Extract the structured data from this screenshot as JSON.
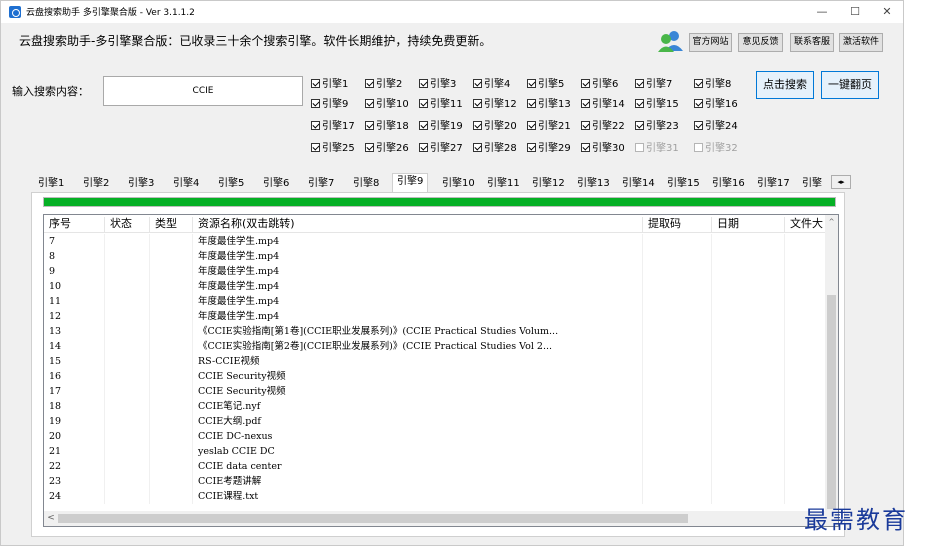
{
  "window": {
    "title": "云盘搜索助手 多引擎聚合版 - Ver 3.1.1.2",
    "min_glyph": "—",
    "max_glyph": "☐",
    "close_glyph": "✕"
  },
  "header": {
    "slogan": "云盘搜索助手-多引擎聚合版：已收录三十余个搜索引擎。软件长期维护，持续免费更新。",
    "user_icon": "user-group-icon",
    "buttons": [
      "官方网站",
      "意见反馈",
      "联系客服",
      "激活软件"
    ]
  },
  "search": {
    "label": "输入搜索内容：",
    "value": "CCIE",
    "search_button": "点击搜索",
    "next_page_button": "一键翻页"
  },
  "engines": [
    {
      "label": "引擎1",
      "checked": true
    },
    {
      "label": "引擎2",
      "checked": true
    },
    {
      "label": "引擎3",
      "checked": true
    },
    {
      "label": "引擎4",
      "checked": true
    },
    {
      "label": "引擎5",
      "checked": true
    },
    {
      "label": "引擎6",
      "checked": true
    },
    {
      "label": "引擎7",
      "checked": true
    },
    {
      "label": "引擎8",
      "checked": true
    },
    {
      "label": "引擎9",
      "checked": true
    },
    {
      "label": "引擎10",
      "checked": true
    },
    {
      "label": "引擎11",
      "checked": true
    },
    {
      "label": "引擎12",
      "checked": true
    },
    {
      "label": "引擎13",
      "checked": true
    },
    {
      "label": "引擎14",
      "checked": true
    },
    {
      "label": "引擎15",
      "checked": true
    },
    {
      "label": "引擎16",
      "checked": true
    },
    {
      "label": "引擎17",
      "checked": true
    },
    {
      "label": "引擎18",
      "checked": true
    },
    {
      "label": "引擎19",
      "checked": true
    },
    {
      "label": "引擎20",
      "checked": true
    },
    {
      "label": "引擎21",
      "checked": true
    },
    {
      "label": "引擎22",
      "checked": true
    },
    {
      "label": "引擎23",
      "checked": true
    },
    {
      "label": "引擎24",
      "checked": true
    },
    {
      "label": "引擎25",
      "checked": true
    },
    {
      "label": "引擎26",
      "checked": true
    },
    {
      "label": "引擎27",
      "checked": true
    },
    {
      "label": "引擎28",
      "checked": true
    },
    {
      "label": "引擎29",
      "checked": true
    },
    {
      "label": "引擎30",
      "checked": true
    },
    {
      "label": "引擎31",
      "checked": false,
      "disabled": true
    },
    {
      "label": "引擎32",
      "checked": false,
      "disabled": true
    }
  ],
  "tabs": {
    "items": [
      "引擎1",
      "引擎2",
      "引擎3",
      "引擎4",
      "引擎5",
      "引擎6",
      "引擎7",
      "引擎8",
      "引擎9",
      "引擎10",
      "引擎11",
      "引擎12",
      "引擎13",
      "引擎14",
      "引擎15",
      "引擎16",
      "引擎17",
      "引擎"
    ],
    "active_index": 8,
    "scroll_glyph": "◂▸"
  },
  "progress": {
    "fraction": 1.0,
    "color": "#06b025"
  },
  "table": {
    "columns": [
      "序号",
      "状态",
      "类型",
      "资源名称(双击跳转)",
      "提取码",
      "日期",
      "文件大"
    ],
    "rows": [
      [
        "7",
        "",
        "",
        "年度最佳学生.mp4",
        "",
        "",
        ""
      ],
      [
        "8",
        "",
        "",
        "年度最佳学生.mp4",
        "",
        "",
        ""
      ],
      [
        "9",
        "",
        "",
        "年度最佳学生.mp4",
        "",
        "",
        ""
      ],
      [
        "10",
        "",
        "",
        "年度最佳学生.mp4",
        "",
        "",
        ""
      ],
      [
        "11",
        "",
        "",
        "年度最佳学生.mp4",
        "",
        "",
        ""
      ],
      [
        "12",
        "",
        "",
        "年度最佳学生.mp4",
        "",
        "",
        ""
      ],
      [
        "13",
        "",
        "",
        "《CCIE实验指南[第1卷](CCIE职业发展系列)》(CCIE Practical Studies Volum...",
        "",
        "",
        ""
      ],
      [
        "14",
        "",
        "",
        "《CCIE实验指南[第2卷](CCIE职业发展系列)》(CCIE Practical Studies Vol 2...",
        "",
        "",
        ""
      ],
      [
        "15",
        "",
        "",
        "RS-CCIE视频",
        "",
        "",
        ""
      ],
      [
        "16",
        "",
        "",
        "CCIE Security视频",
        "",
        "",
        ""
      ],
      [
        "17",
        "",
        "",
        "CCIE Security视频",
        "",
        "",
        ""
      ],
      [
        "18",
        "",
        "",
        "CCIE笔记.nyf",
        "",
        "",
        ""
      ],
      [
        "19",
        "",
        "",
        "CCIE大纲.pdf",
        "",
        "",
        ""
      ],
      [
        "20",
        "",
        "",
        "CCIE DC-nexus",
        "",
        "",
        ""
      ],
      [
        "21",
        "",
        "",
        "yeslab CCIE DC",
        "",
        "",
        ""
      ],
      [
        "22",
        "",
        "",
        "CCIE data center",
        "",
        "",
        ""
      ],
      [
        "23",
        "",
        "",
        "CCIE考题讲解",
        "",
        "",
        ""
      ],
      [
        "24",
        "",
        "",
        "CCIE课程.txt",
        "",
        "",
        ""
      ]
    ],
    "scroll_up_glyph": "^",
    "scroll_left_glyph": "<"
  },
  "watermark": "最需教育"
}
